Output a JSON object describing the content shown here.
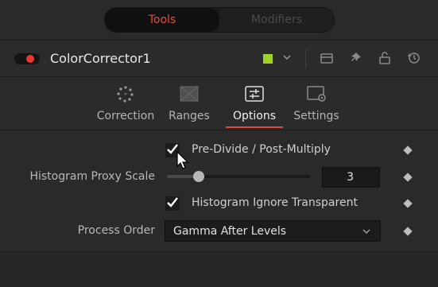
{
  "top_tabs": {
    "tools": "Tools",
    "modifiers": "Modifiers"
  },
  "tool": {
    "name": "ColorCorrector1",
    "color_swatch": "#9ed12a",
    "enabled": true
  },
  "header_icons": [
    "chevron-down-icon",
    "window-icon",
    "pin-icon",
    "lock-icon",
    "reset-icon"
  ],
  "tabs": [
    {
      "label": "Correction",
      "icon": "color-wheel-icon",
      "active": false
    },
    {
      "label": "Ranges",
      "icon": "ranges-icon",
      "active": false
    },
    {
      "label": "Options",
      "icon": "sliders-icon",
      "active": true
    },
    {
      "label": "Settings",
      "icon": "settings-icon",
      "active": false
    }
  ],
  "options": {
    "pre_divide": {
      "label": "Pre-Divide / Post-Multiply",
      "checked": true
    },
    "histogram_proxy_scale": {
      "label": "Histogram Proxy Scale",
      "value": "3",
      "min": 1,
      "max": 10
    },
    "histogram_ignore_transparent": {
      "label": "Histogram Ignore Transparent",
      "checked": true
    },
    "process_order": {
      "label": "Process Order",
      "value": "Gamma After Levels"
    }
  },
  "colors": {
    "accent": "#e64b3c",
    "tab_underline": "#d94a3a",
    "background": "#262626"
  }
}
